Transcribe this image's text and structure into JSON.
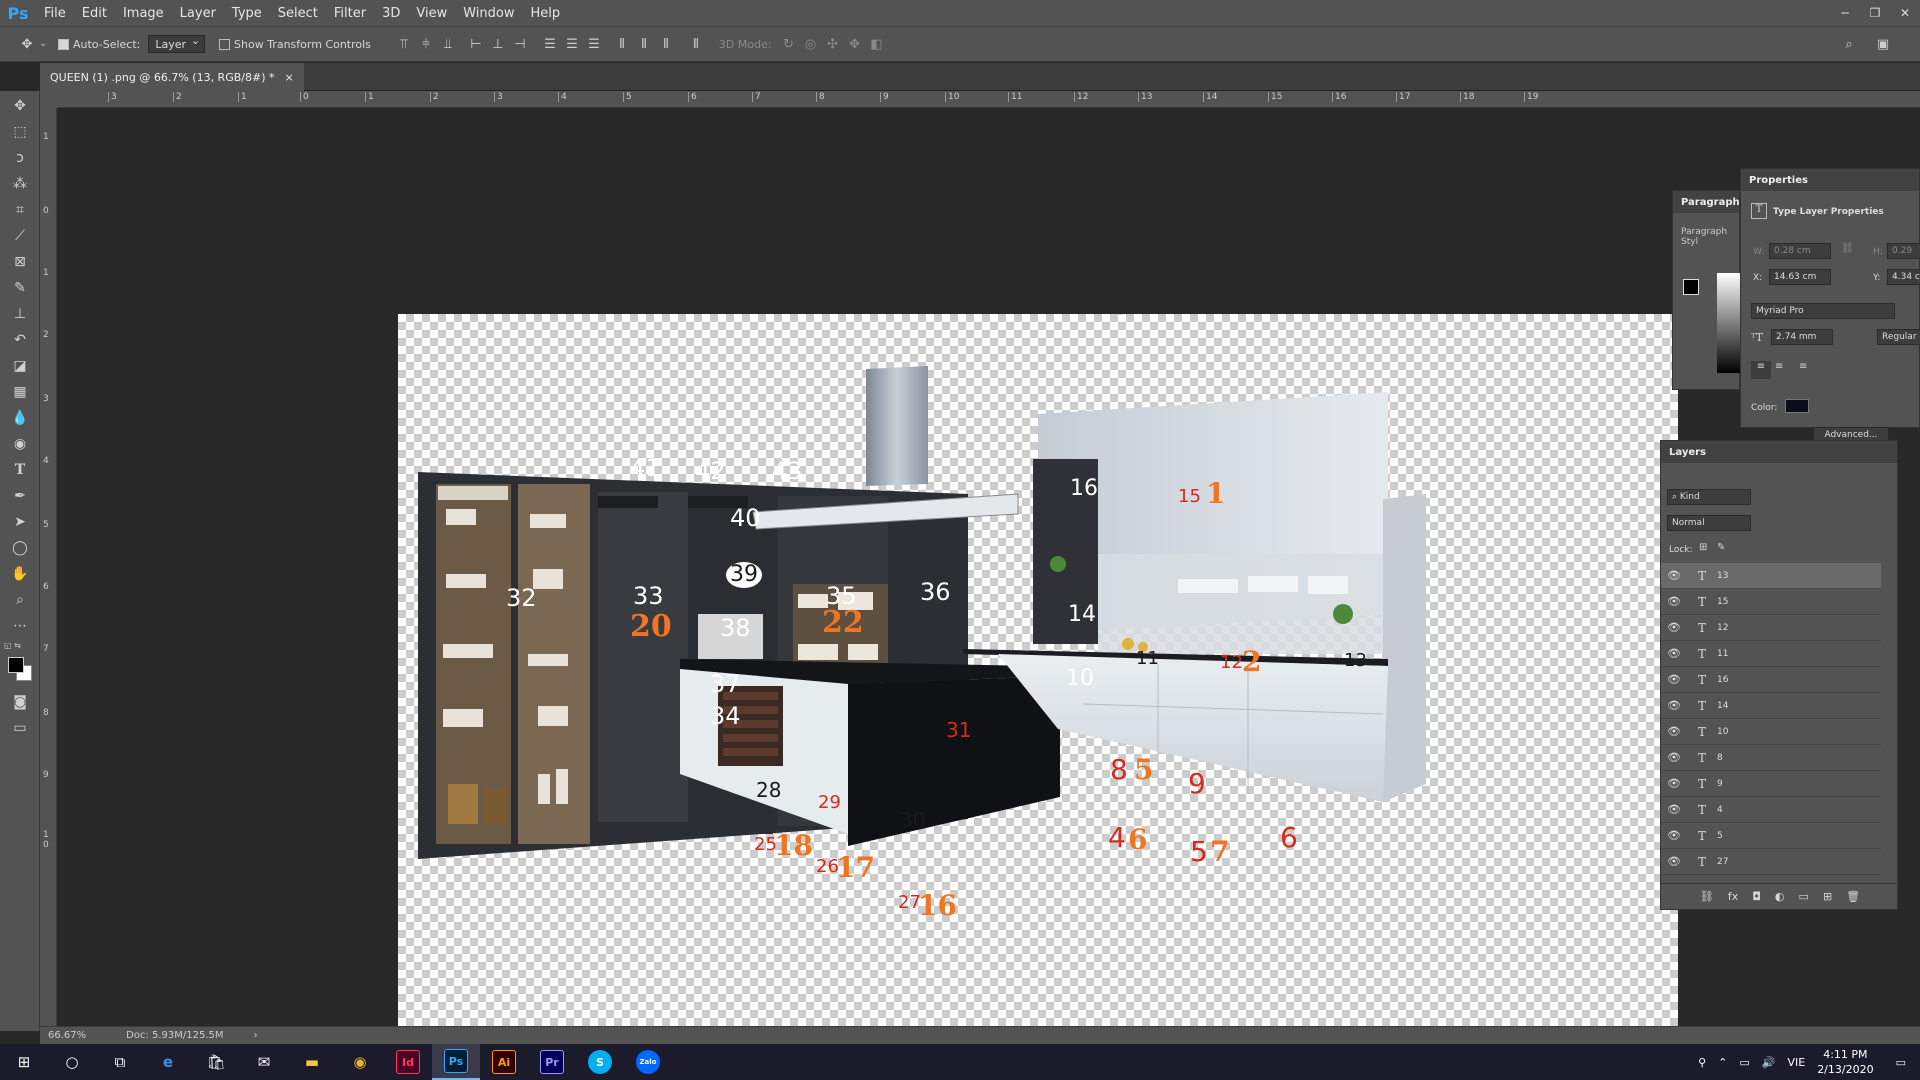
{
  "app": {
    "logo": "Ps"
  },
  "menu": [
    "File",
    "Edit",
    "Image",
    "Layer",
    "Type",
    "Select",
    "Filter",
    "3D",
    "View",
    "Window",
    "Help"
  ],
  "options": {
    "auto_select_label": "Auto-Select:",
    "auto_select_value": "Layer",
    "show_transform_label": "Show Transform Controls",
    "mode_label": "3D Mode:"
  },
  "document": {
    "tab_title": "QUEEN (1) .png @ 66.7% (13, RGB/8#) *",
    "close": "×"
  },
  "ruler": {
    "h_labels": [
      "3",
      "2",
      "1",
      "0",
      "1",
      "2",
      "3",
      "4",
      "5",
      "6",
      "7",
      "8",
      "9",
      "10",
      "11",
      "12",
      "13",
      "14",
      "15",
      "16",
      "17",
      "18",
      "19"
    ],
    "v_labels": [
      "1",
      "0",
      "1",
      "2",
      "3",
      "4",
      "5",
      "6",
      "7",
      "8",
      "9",
      "1\n0"
    ]
  },
  "status": {
    "zoom": "66.67%",
    "doc": "Doc: 5.93M/125.5M",
    "arrow": "›"
  },
  "canvas_labels": [
    {
      "t": "41",
      "c": "w"
    },
    {
      "t": "42",
      "c": "w"
    },
    {
      "t": "43",
      "c": "w"
    },
    {
      "t": "40",
      "c": "w"
    },
    {
      "t": "39",
      "c": "k"
    },
    {
      "t": "32",
      "c": "w"
    },
    {
      "t": "33",
      "c": "w"
    },
    {
      "t": "20",
      "c": "o"
    },
    {
      "t": "35",
      "c": "w"
    },
    {
      "t": "22",
      "c": "o"
    },
    {
      "t": "36",
      "c": "w"
    },
    {
      "t": "38",
      "c": "w"
    },
    {
      "t": "37",
      "c": "w"
    },
    {
      "t": "34",
      "c": "w"
    },
    {
      "t": "31",
      "c": "r"
    },
    {
      "t": "28",
      "c": "k"
    },
    {
      "t": "29",
      "c": "r"
    },
    {
      "t": "30",
      "c": "k"
    },
    {
      "t": "25",
      "c": "r"
    },
    {
      "t": "18",
      "c": "o"
    },
    {
      "t": "26",
      "c": "r"
    },
    {
      "t": "17",
      "c": "o"
    },
    {
      "t": "27",
      "c": "r"
    },
    {
      "t": "16",
      "c": "o"
    },
    {
      "t": "16",
      "c": "w"
    },
    {
      "t": "14",
      "c": "w"
    },
    {
      "t": "10",
      "c": "w"
    },
    {
      "t": "15",
      "c": "r"
    },
    {
      "t": "1",
      "c": "o"
    },
    {
      "t": "11",
      "c": "k"
    },
    {
      "t": "12",
      "c": "r"
    },
    {
      "t": "2",
      "c": "o"
    },
    {
      "t": "13",
      "c": "k"
    },
    {
      "t": "8",
      "c": "r"
    },
    {
      "t": "5",
      "c": "o"
    },
    {
      "t": "9",
      "c": "r"
    },
    {
      "t": "4",
      "c": "r"
    },
    {
      "t": "6",
      "c": "o"
    },
    {
      "t": "5",
      "c": "r"
    },
    {
      "t": "7",
      "c": "o"
    },
    {
      "t": "6",
      "c": "r"
    }
  ],
  "panels": {
    "paragraph_tab": "Paragraph",
    "paragraph_styles": "Paragraph Styl",
    "properties_tab": "Properties",
    "type_layer_props": "Type Layer Properties",
    "w_label": "W:",
    "w_value": "0.28 cm",
    "h_label": "H:",
    "h_value": "0.29",
    "x_label": "X:",
    "x_value": "14.63 cm",
    "y_label": "Y:",
    "y_value": "4.34 c",
    "font": "Myriad Pro",
    "size": "2.74 mm",
    "style": "Regular",
    "color_label": "Color:",
    "advanced": "Advanced...",
    "layers_tab": "Layers",
    "kind": "Kind",
    "blend": "Normal",
    "lock_label": "Lock:",
    "layers": [
      "13",
      "15",
      "12",
      "11",
      "16",
      "14",
      "10",
      "8",
      "9",
      "4",
      "5",
      "27"
    ]
  },
  "taskbar": {
    "apps": [
      "Id",
      "Ps",
      "Ai",
      "Pr",
      "S",
      "Zalo"
    ],
    "lang": "VIE",
    "time": "4:11 PM",
    "date": "2/13/2020"
  },
  "colors": {
    "accent": "#31a8ff",
    "orange": "#f07522",
    "red": "#d82a1c",
    "panel": "#535353"
  }
}
